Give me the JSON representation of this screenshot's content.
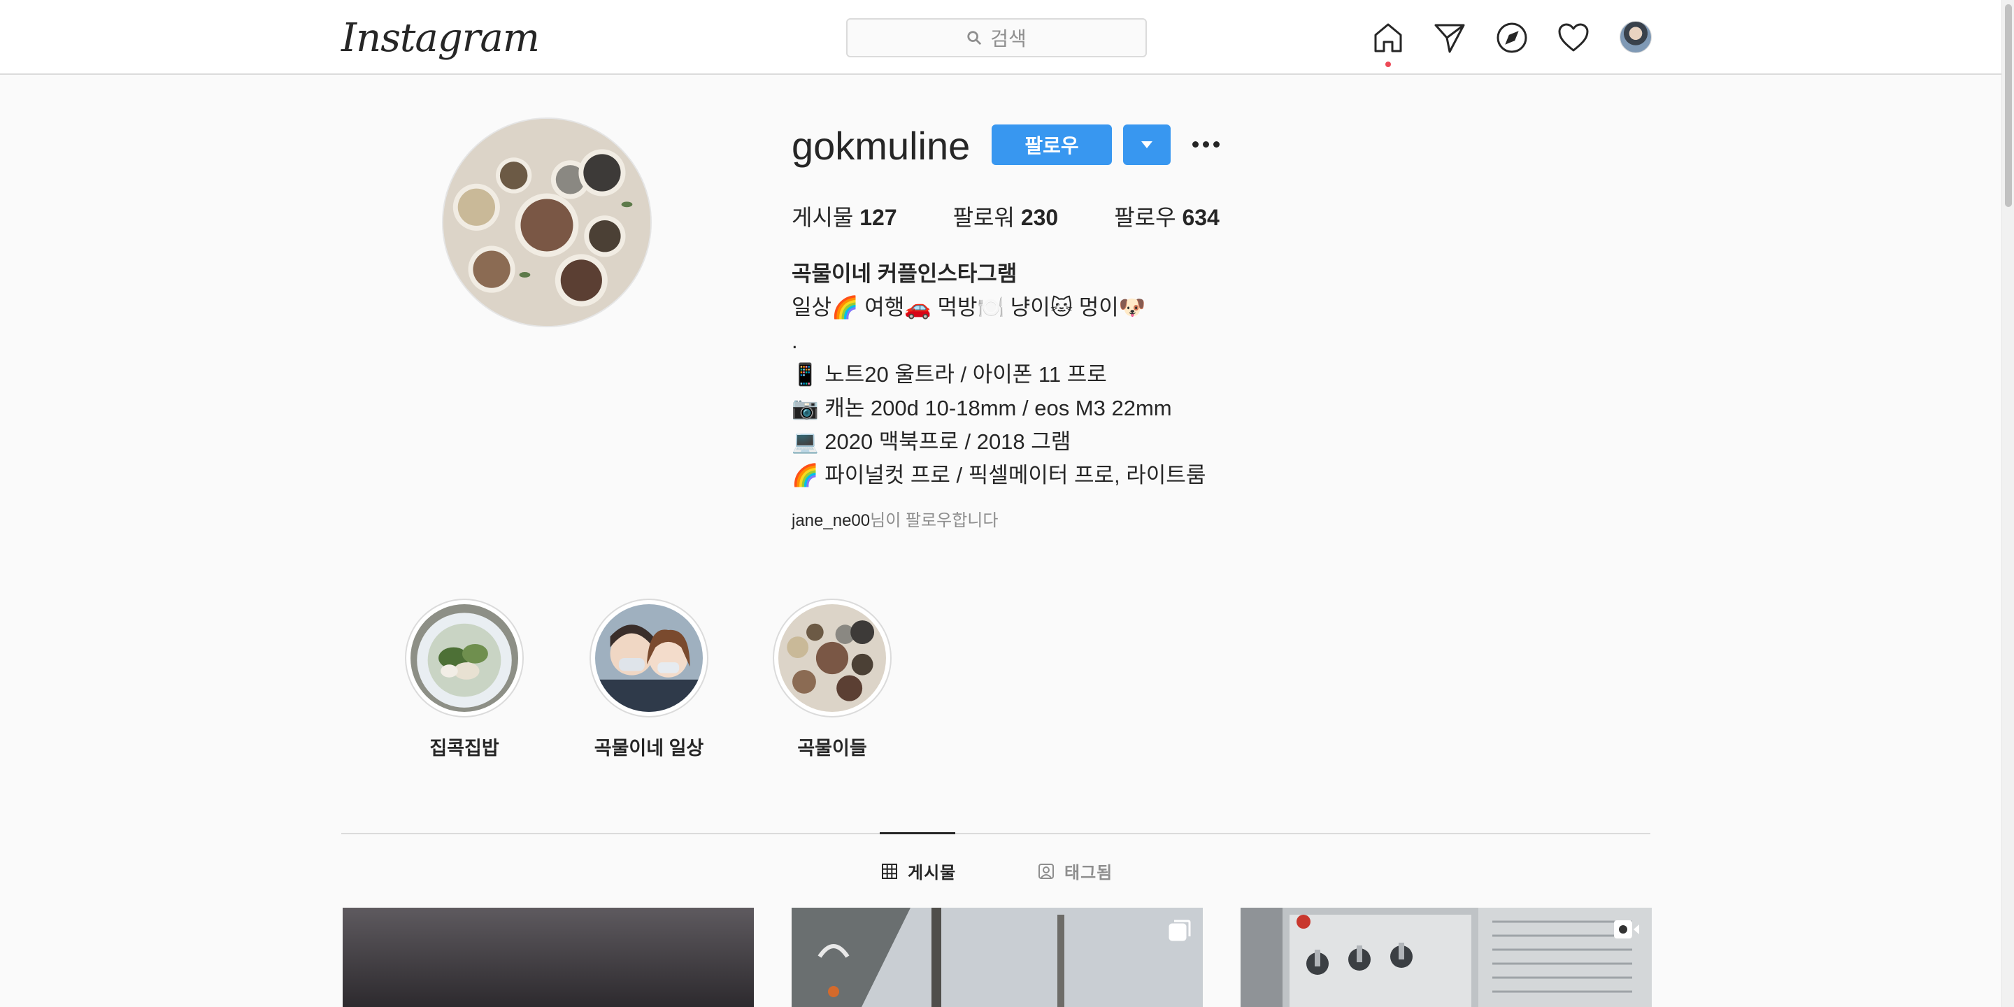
{
  "app": {
    "logo_text": "Instagram"
  },
  "nav": {
    "search_placeholder": "검색",
    "icons": [
      "home-icon",
      "direct-message-icon",
      "explore-icon",
      "activity-heart-icon",
      "profile-avatar"
    ],
    "notification_dot_color": "#ed4956"
  },
  "profile": {
    "username": "gokmuline",
    "follow_label": "팔로우",
    "stats": [
      {
        "label": "게시물",
        "value": "127"
      },
      {
        "label": "팔로워",
        "value": "230"
      },
      {
        "label": "팔로우",
        "value": "634"
      }
    ],
    "bio": {
      "name": "곡물이네 커플인스타그램",
      "lines": [
        "일상🌈 여행🚗 먹방🍽️ 냥이🐱 멍이🐶",
        ".",
        "📱 노트20 울트라 / 아이폰 11 프로",
        "📷 캐논 200d 10-18mm / eos M3 22mm",
        "💻 2020 맥북프로 / 2018 그램",
        "🌈 파이널컷 프로 / 픽셀메이터 프로, 라이트룸"
      ]
    },
    "followed_by": {
      "user": "jane_ne00",
      "suffix": "님이 팔로우합니다"
    }
  },
  "highlights": [
    {
      "label": "집콕집밥"
    },
    {
      "label": "곡물이네 일상"
    },
    {
      "label": "곡물이들"
    }
  ],
  "tabs": [
    {
      "label": "게시물",
      "active": true
    },
    {
      "label": "태그됨",
      "active": false
    }
  ],
  "colors": {
    "accent": "#3897f0",
    "border": "#dbdbdb",
    "text": "#262626",
    "muted": "#8e8e8e"
  }
}
